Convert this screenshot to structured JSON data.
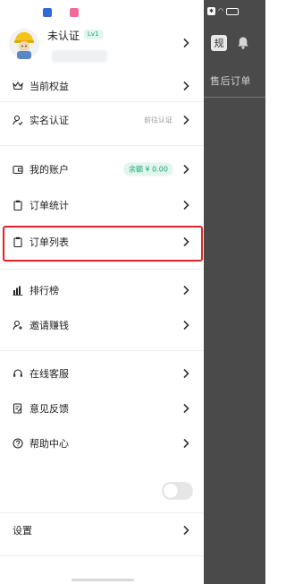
{
  "overlay": {
    "rule_label": "规",
    "tab_label": "售后订单"
  },
  "profile": {
    "name": "未认证",
    "level": "Lv1"
  },
  "menu": {
    "benefits": "当前权益",
    "realname": "实名认证",
    "realname_hint": "前往认证",
    "account": "我的账户",
    "balance": "余额 ¥ 0.00",
    "order_stats": "订单统计",
    "order_list": "订单列表",
    "ranking": "排行榜",
    "invite": "邀请赚钱",
    "online_service": "在线客服",
    "feedback": "意见反馈",
    "help": "帮助中心",
    "settings": "设置"
  },
  "colors": {
    "accent_green": "#15a374",
    "highlight_red": "#e52222"
  }
}
